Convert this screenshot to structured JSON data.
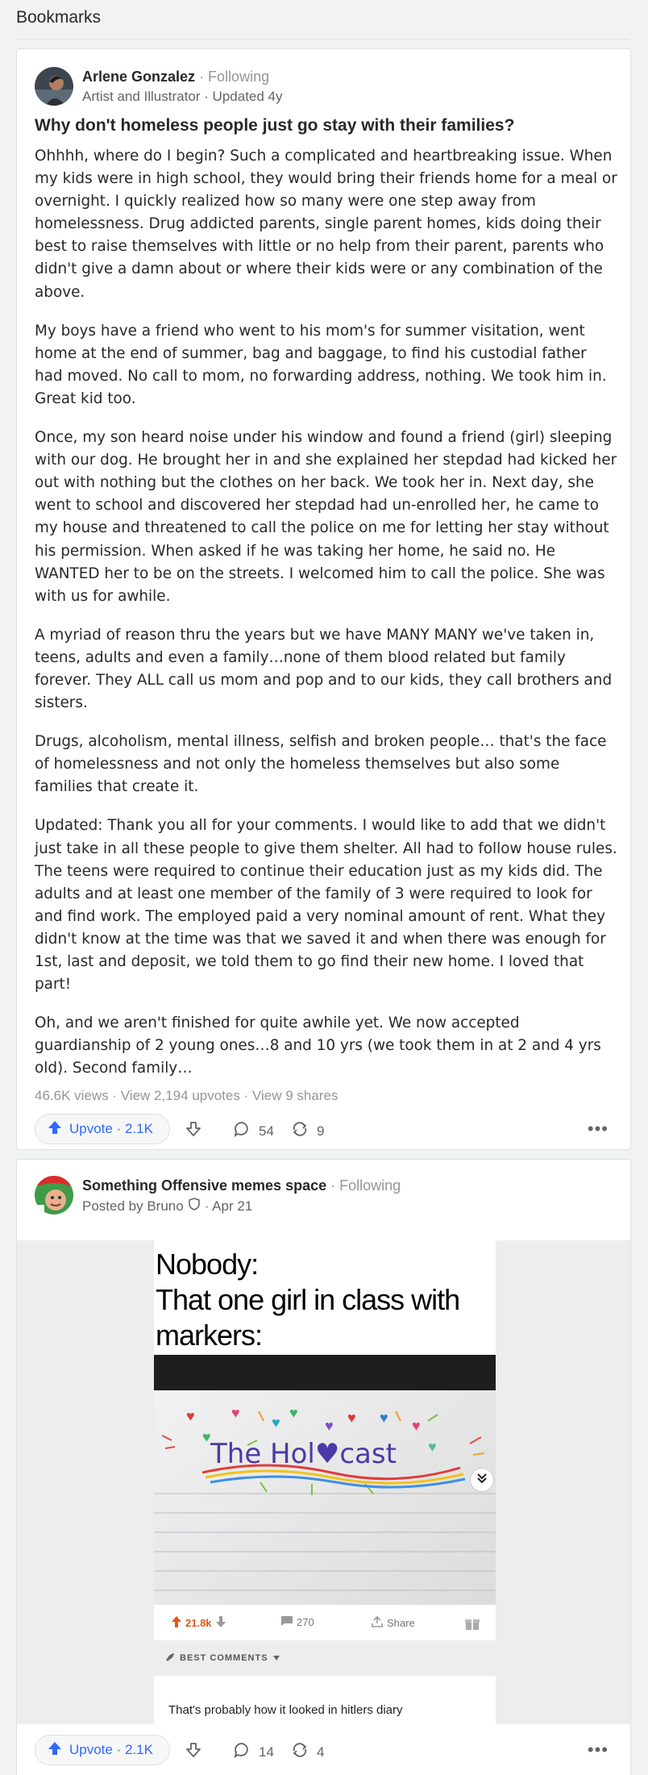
{
  "page": {
    "title": "Bookmarks"
  },
  "answer": {
    "author": "Arlene Gonzalez",
    "follow": "· Following",
    "credential": "Artist and Illustrator · Updated 4y",
    "question": "Why don't homeless people just go stay with their families?",
    "paragraphs": [
      "Ohhhh, where do I begin? Such a complicated and heartbreaking issue. When my kids were in high school, they would bring their friends home for a meal or overnight. I quickly realized how so many were one step away from homelessness. Drug addicted parents, single parent homes, kids doing their best to raise themselves with little or no help from their parent, parents who didn't give a damn about or where their kids were or any combination of the above.",
      "My boys have a friend who went to his mom's for summer visitation, went home at the end of summer, bag and baggage, to find his custodial father had moved. No call to mom, no forwarding address, nothing. We took him in. Great kid too.",
      "Once, my son heard noise under his window and found a friend (girl) sleeping with our dog. He brought her in and she explained her stepdad had kicked her out with nothing but the clothes on her back. We took her in. Next day, she went to school and discovered her stepdad had un-enrolled her, he came to my house and threatened to call the police on me for letting her stay without his permission. When asked if he was taking her home, he said no. He WANTED her to be on the streets. I welcomed him to call the police. She was with us for awhile.",
      "A myriad of reason thru the years but we have MANY MANY we've taken in, teens, adults and even a family…none of them blood related but family forever. They ALL call us mom and pop and to our kids, they call brothers and sisters.",
      "Drugs, alcoholism, mental illness, selfish and broken people… that's the face of homelessness and not only the homeless themselves but also some families that create it.",
      "Updated: Thank you all for your comments. I would like to add that we didn't just take in all these people to give them shelter. All had to follow house rules. The teens were required to continue their education just as my kids did. The adults and at least one member of the family of 3 were required to look for and find work. The employed paid a very nominal amount of rent. What they didn't know at the time was that we saved it and when there was enough for 1st, last and deposit, we told them to go find their new home. I loved that part!",
      "Oh, and we aren't finished for quite awhile yet. We now accepted guardianship of 2 young ones…8 and 10 yrs (we took them in at 2 and 4 yrs old). Second family…"
    ],
    "stats": "46.6K views · View 2,194 upvotes · View 9 shares",
    "upvote_label": "Upvote · 2.1K",
    "comments": "54",
    "shares": "9"
  },
  "post": {
    "space": "Something Offensive memes space",
    "follow": "· Following",
    "posted_by": "Posted by Bruno",
    "date": "· Apr 21",
    "meme": {
      "caption_lines": [
        "Nobody:",
        "That one girl in class with",
        "markers:"
      ],
      "drawing_text": "The Hol♥cast",
      "upvotes": "21.8k",
      "comments": "270",
      "share": "Share",
      "best_comments": "BEST COMMENTS",
      "top_comment": "That's probably how it looked in hitlers diary"
    },
    "upvote_label": "Upvote · 2.1K",
    "comments": "14",
    "shares": "4"
  },
  "colors": {
    "accent": "#2e69ff",
    "meme_upvote": "#e2571e",
    "text": "#282829",
    "muted": "#939598"
  },
  "icons": [
    "upvote-arrow-icon",
    "downvote-arrow-icon",
    "comment-icon",
    "share-icon",
    "more-icon",
    "moderator-shield-icon",
    "chevron-down-icon",
    "gift-icon"
  ]
}
